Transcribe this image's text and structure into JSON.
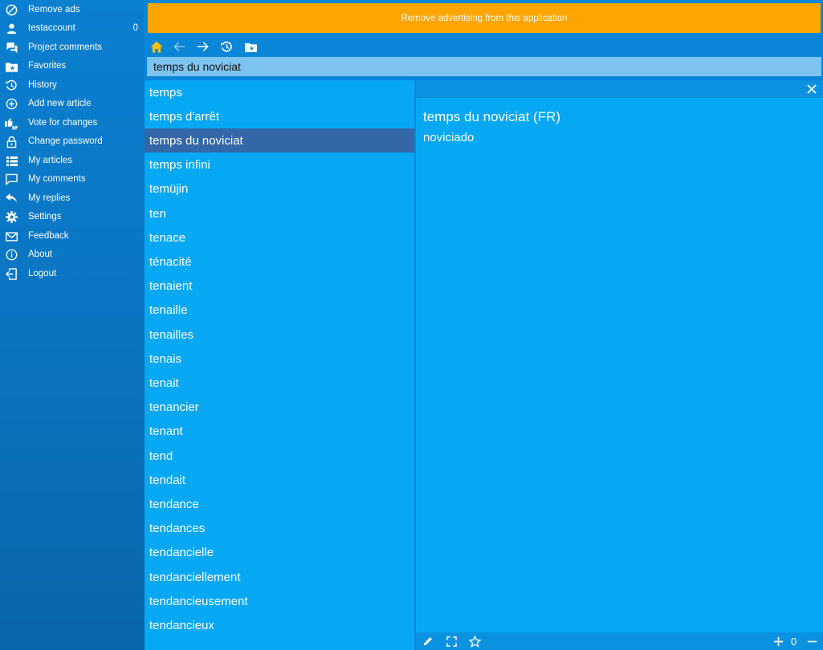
{
  "sidebar": {
    "items": [
      {
        "label": "Remove ads",
        "icon": "block-icon"
      },
      {
        "label": "testaccount",
        "icon": "user-icon",
        "count": "0"
      },
      {
        "label": "Project comments",
        "icon": "comments-icon"
      },
      {
        "label": "Favorites",
        "icon": "folder-star-icon"
      },
      {
        "label": "History",
        "icon": "history-icon"
      },
      {
        "label": "Add new article",
        "icon": "plus-circle-icon"
      },
      {
        "label": "Vote for changes",
        "icon": "thumbs-icon"
      },
      {
        "label": "Change password",
        "icon": "lock-icon"
      },
      {
        "label": "My articles",
        "icon": "list-icon"
      },
      {
        "label": "My comments",
        "icon": "comment-icon"
      },
      {
        "label": "My replies",
        "icon": "reply-icon"
      },
      {
        "label": "Settings",
        "icon": "gear-icon"
      },
      {
        "label": "Feedback",
        "icon": "mail-icon"
      },
      {
        "label": "About",
        "icon": "info-icon"
      },
      {
        "label": "Logout",
        "icon": "logout-icon"
      }
    ]
  },
  "ad": {
    "label": "Remove advertising from this application"
  },
  "search": {
    "value": "temps du noviciat"
  },
  "list": {
    "items": [
      "temps",
      "temps d'arrêt",
      "temps du noviciat",
      "temps infini",
      "temüjin",
      "ten",
      "tenace",
      "ténacité",
      "tenaient",
      "tenaille",
      "tenailles",
      "tenais",
      "tenait",
      "tenancier",
      "tenant",
      "tend",
      "tendait",
      "tendance",
      "tendances",
      "tendancielle",
      "tendanciellement",
      "tendancieusement",
      "tendancieux"
    ],
    "selected_index": 2
  },
  "detail": {
    "title": "temps du noviciat (FR)",
    "translation": "noviciado",
    "zoom": "0"
  },
  "colors": {
    "accent": "#ffa500",
    "selected": "#3367a8",
    "panel": "#06a8f4",
    "home_icon": "#ffc107"
  }
}
